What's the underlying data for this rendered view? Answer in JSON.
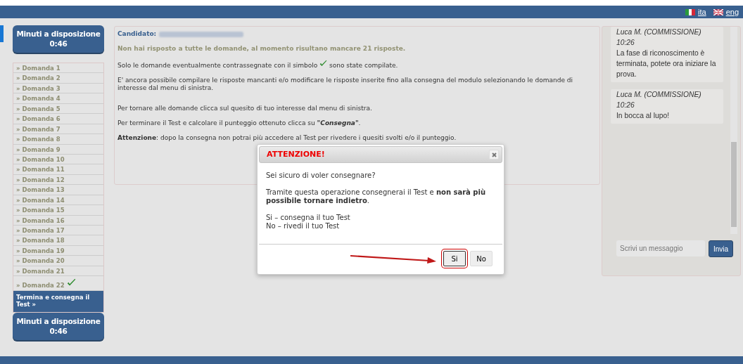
{
  "header": {
    "languages": [
      {
        "label": "ita"
      },
      {
        "label": "eng"
      }
    ]
  },
  "timer_top": {
    "label": "Minuti a disposizione",
    "time": "0:46"
  },
  "sidebar": {
    "items": [
      {
        "label": "» Domanda 1",
        "answered": false
      },
      {
        "label": "» Domanda 2",
        "answered": false
      },
      {
        "label": "» Domanda 3",
        "answered": false
      },
      {
        "label": "» Domanda 4",
        "answered": false
      },
      {
        "label": "» Domanda 5",
        "answered": false
      },
      {
        "label": "» Domanda 6",
        "answered": false
      },
      {
        "label": "» Domanda 7",
        "answered": false
      },
      {
        "label": "» Domanda 8",
        "answered": false
      },
      {
        "label": "» Domanda 9",
        "answered": false
      },
      {
        "label": "» Domanda 10",
        "answered": false
      },
      {
        "label": "» Domanda 11",
        "answered": false
      },
      {
        "label": "» Domanda 12",
        "answered": false
      },
      {
        "label": "» Domanda 13",
        "answered": false
      },
      {
        "label": "» Domanda 14",
        "answered": false
      },
      {
        "label": "» Domanda 15",
        "answered": false
      },
      {
        "label": "» Domanda 16",
        "answered": false
      },
      {
        "label": "» Domanda 17",
        "answered": false
      },
      {
        "label": "» Domanda 18",
        "answered": false
      },
      {
        "label": "» Domanda 19",
        "answered": false
      },
      {
        "label": "» Domanda 20",
        "answered": false
      },
      {
        "label": "» Domanda 21",
        "answered": false
      },
      {
        "label": "» Domanda 22",
        "answered": true
      }
    ],
    "finish_button": "Termina e consegna il Test »"
  },
  "timer_bottom": {
    "label": "Minuti a disposizione",
    "time": "0:46"
  },
  "main": {
    "candidate_label": "Candidato:",
    "warning": "Non hai risposto a tutte le domande, al momento risultano mancare 21 risposte.",
    "check_note": {
      "before": "Solo le domande eventualmente contrassegnate con il simbolo",
      "after": "sono state compilate."
    },
    "paragraphs": [
      "E' ancora possibile compilare le risposte mancanti e/o modificare le risposte inserite fino alla consegna del modulo selezionando le domande di interesse dal menu di sinistra.",
      "Per tornare alle domande clicca sul quesito di tuo interesse dal menu di sinistra.",
      "Per terminare il Test e calcolare il punteggio ottenuto clicca su *\"Consegna\"*.",
      "**Attenzione**: dopo la consegna non potrai più accedere al Test per rivedere i quesiti svolti e/o il punteggio."
    ]
  },
  "chat": {
    "messages": [
      {
        "author": "Luca M. (COMMISSIONE)",
        "time": "10:26",
        "text": "La fase di riconoscimento è terminata, potete ora iniziare la prova."
      },
      {
        "author": "Luca M. (COMMISSIONE)",
        "time": "10:26",
        "text": "In bocca al lupo!"
      }
    ],
    "input": {
      "placeholder": "Scrivi un messaggio"
    },
    "send_button": "Invia"
  },
  "dialog": {
    "title": "ATTENZIONE!",
    "question": "Sei sicuro di voler consegnare?",
    "body": "Tramite questa operazione consegnerai il Test e **non sarà più possibile tornare indietro**.",
    "options": [
      "Si – consegna il tuo Test",
      "No – rivedi il tuo Test"
    ],
    "buttons": [
      {
        "label": "Si",
        "highlighted": true
      },
      {
        "label": "No",
        "highlighted": false
      }
    ]
  }
}
